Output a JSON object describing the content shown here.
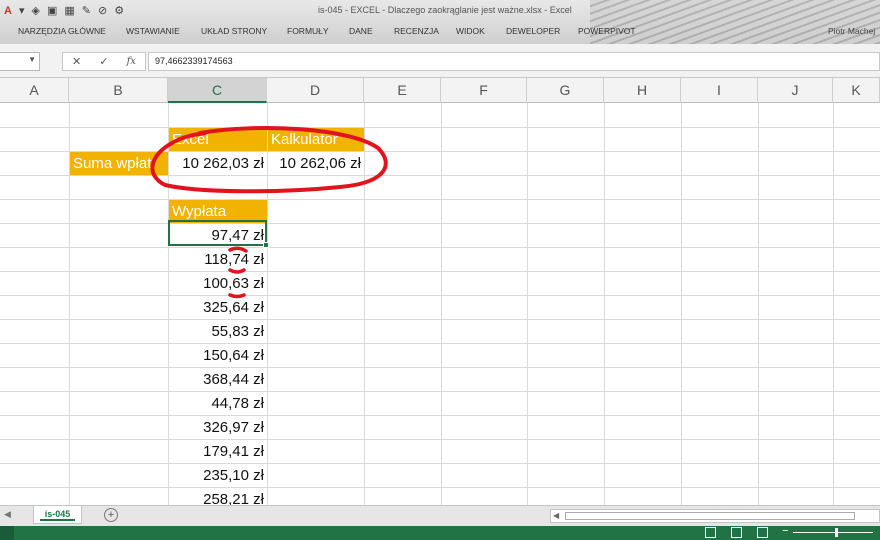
{
  "window": {
    "title": "is-045 - EXCEL - Dlaczego zaokrąglanie jest ważne.xlsx - Excel",
    "user": "Piotr Machej"
  },
  "ribbon_tabs": [
    "NARZĘDZIA GŁÓWNE",
    "WSTAWIANIE",
    "UKŁAD STRONY",
    "FORMUŁY",
    "DANE",
    "RECENZJA",
    "WIDOK",
    "DEWELOPER",
    "POWERPIVOT"
  ],
  "formula_bar": {
    "cancel_symbol": "✕",
    "enter_symbol": "✓",
    "fx_symbol": "fx",
    "value": "97,4662339174563"
  },
  "columns": [
    "A",
    "B",
    "C",
    "D",
    "E",
    "F",
    "G",
    "H",
    "I",
    "J",
    "K"
  ],
  "selected_column": "C",
  "cells": {
    "excel_header": "Excel",
    "calculator_header": "Kalkulator",
    "sum_label": "Suma wpłat",
    "excel_sum": "10 262,03 zł",
    "calculator_sum": "10 262,06 zł",
    "payment_header": "Wypłata"
  },
  "payments": [
    "97,47 zł",
    "118,74 zł",
    "100,63 zł",
    "325,64 zł",
    "55,83 zł",
    "150,64 zł",
    "368,44 zł",
    "44,78 zł",
    "326,97 zł",
    "179,41 zł",
    "235,10 zł",
    "258,21 zł"
  ],
  "sheet_tabs": [
    "is-045"
  ],
  "annotation_color": "#e0141e",
  "accent_color": "#217346",
  "header_fill_color": "#f2b200",
  "icons": [
    "font-color-icon",
    "fill-color-icon",
    "undo-icon",
    "add-sheet-icon",
    "normal-view-icon",
    "page-layout-icon",
    "page-break-icon"
  ]
}
